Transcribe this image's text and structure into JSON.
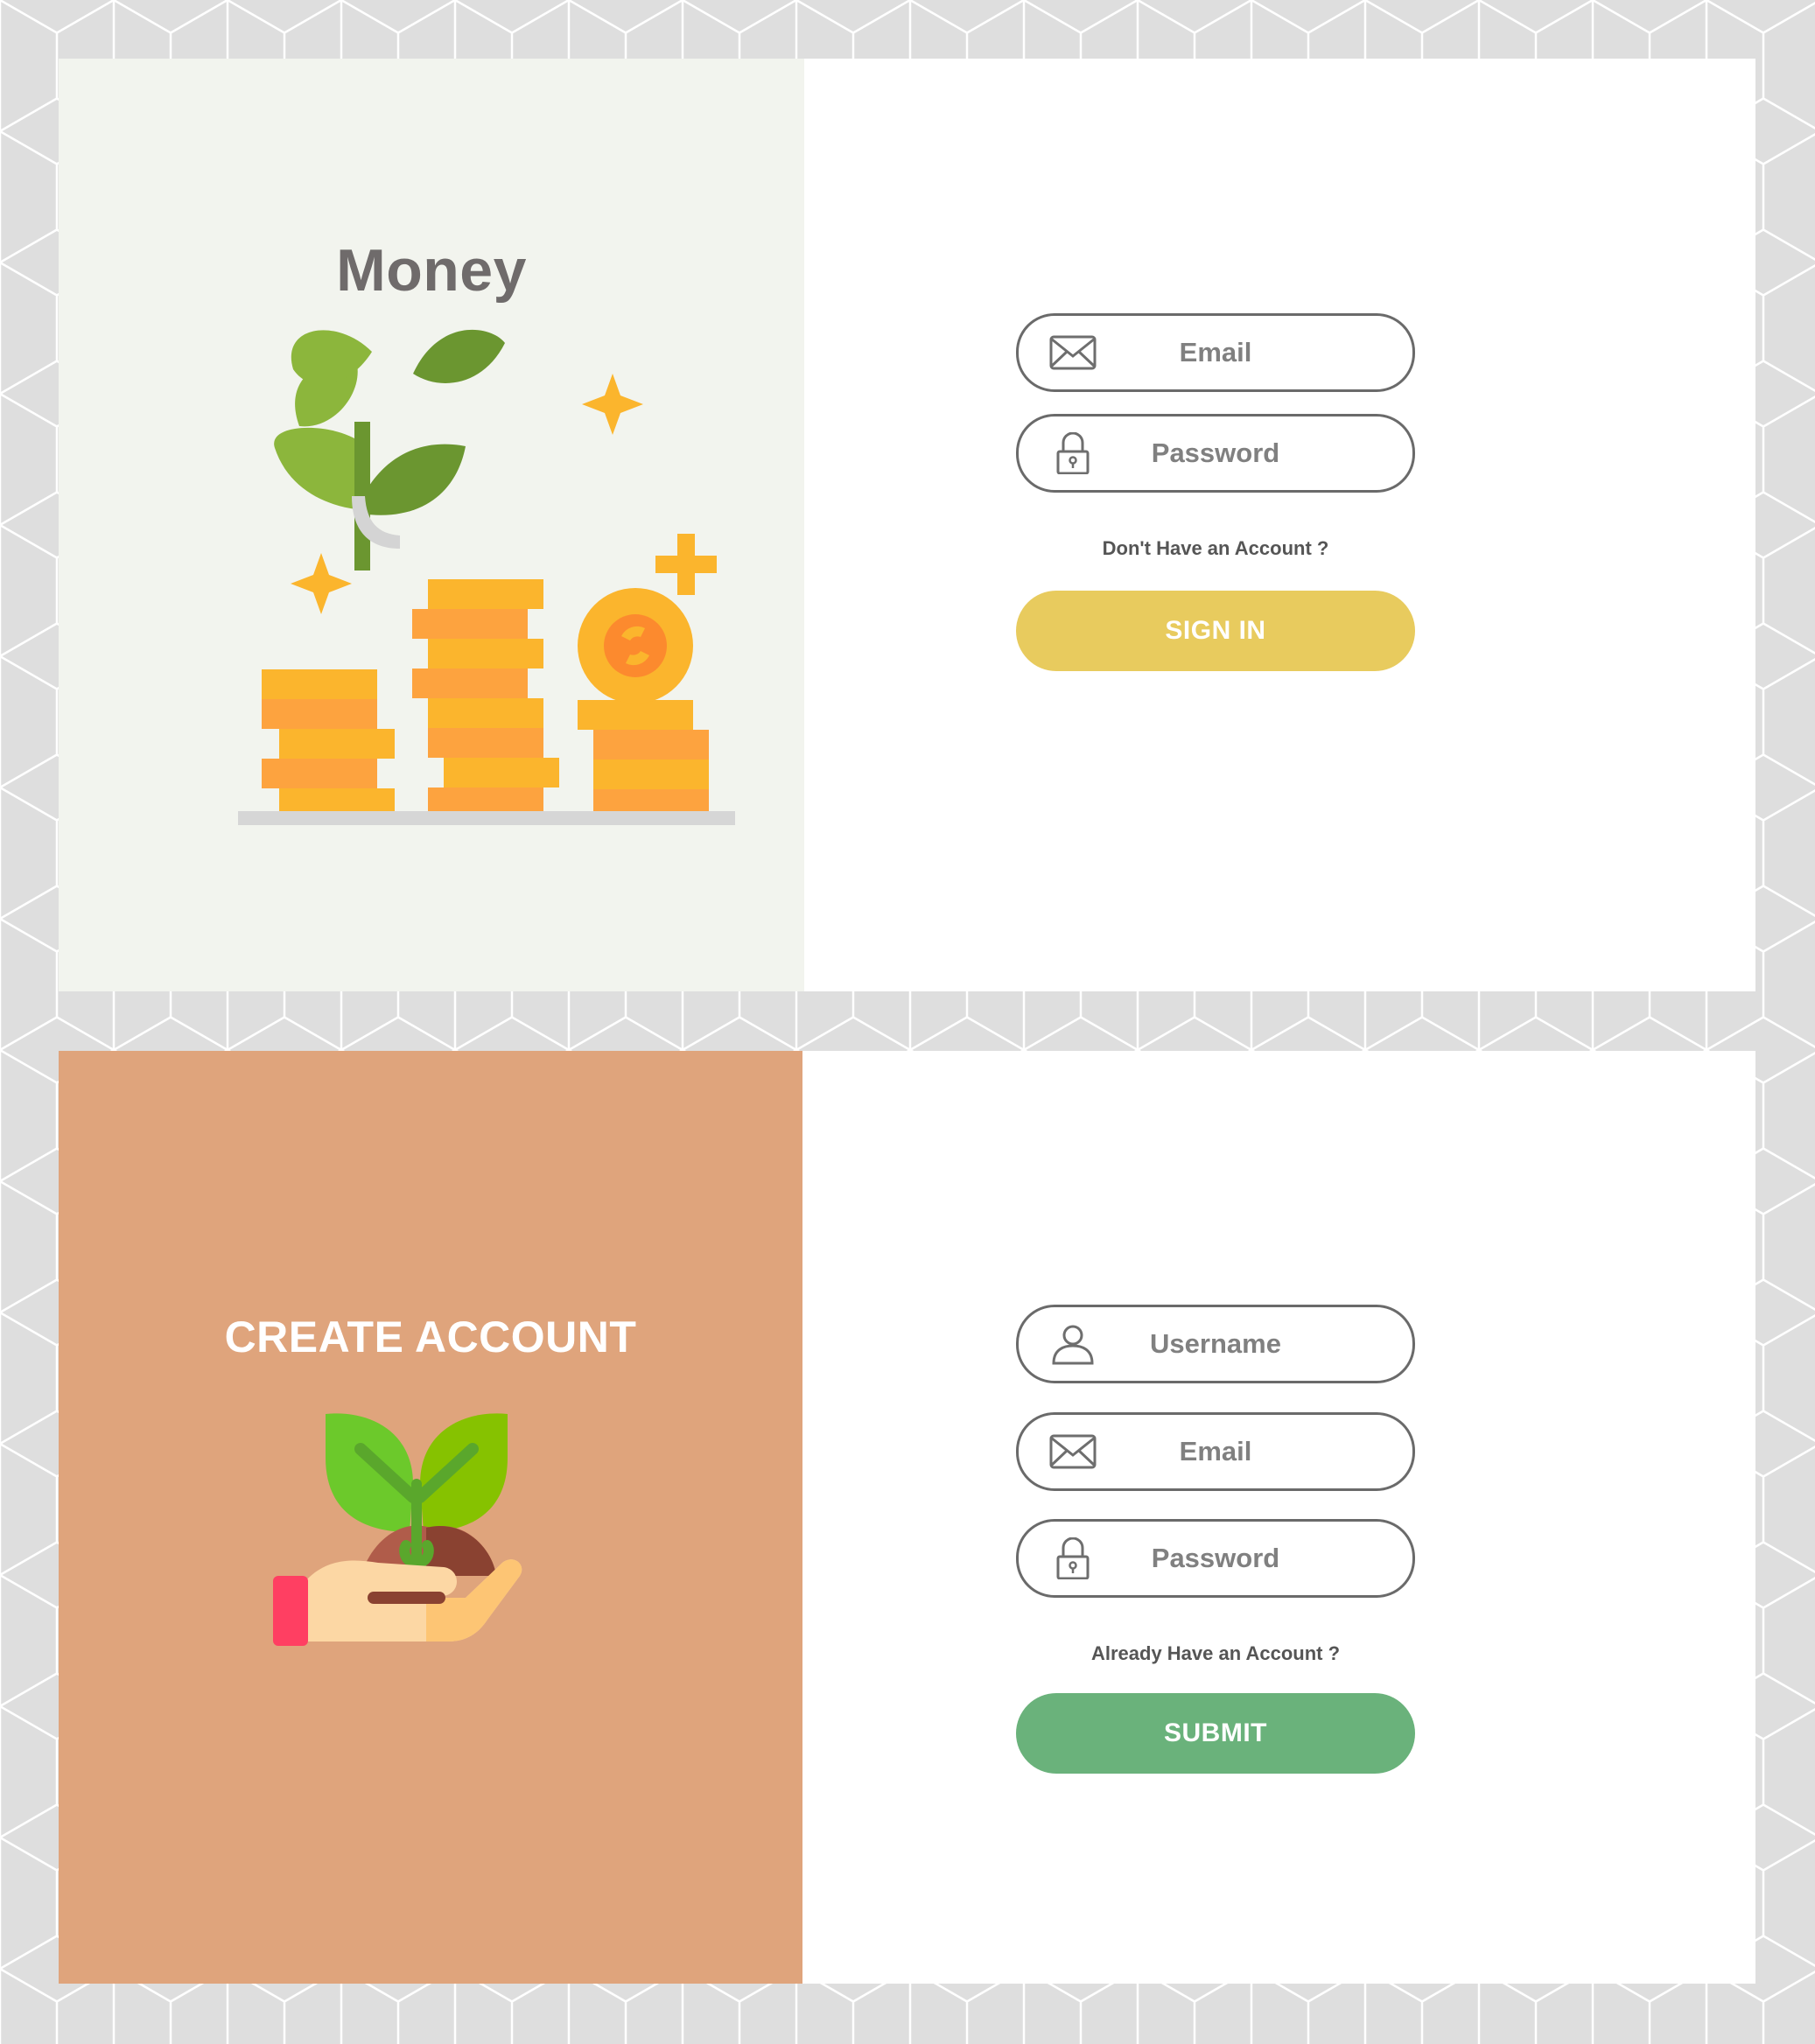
{
  "signin_card": {
    "title": "Money",
    "email_placeholder": "Email",
    "password_placeholder": "Password",
    "switch_link": "Don't Have an Account ?",
    "signin_button": "SIGN IN",
    "icons": [
      "envelope-icon",
      "lock-icon"
    ],
    "colors": {
      "panel_bg": "#f2f4ee",
      "button": "#e8cb5e"
    }
  },
  "signup_card": {
    "title": "CREATE ACCOUNT",
    "username_placeholder": "Username",
    "email_placeholder": "Email",
    "password_placeholder": "Password",
    "switch_link": "Already Have an Account ?",
    "submit_button": "SUBMIT",
    "icons": [
      "user-icon",
      "envelope-icon",
      "lock-icon"
    ],
    "colors": {
      "panel_bg": "#dfa47c",
      "button": "#6ab27b"
    }
  }
}
